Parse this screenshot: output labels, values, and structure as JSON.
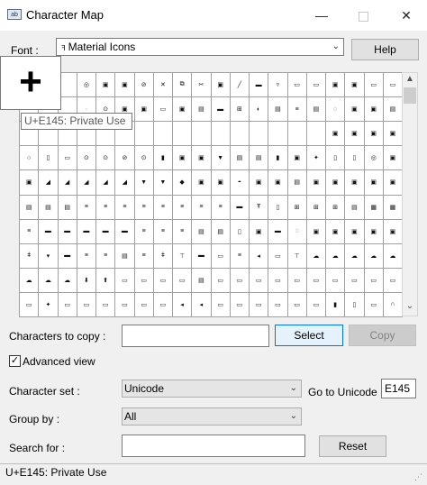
{
  "window": {
    "title": "Character Map",
    "app_icon": "charmap-icon",
    "minimize_glyph": "—",
    "close_glyph": "✕"
  },
  "font": {
    "label": "Font :",
    "value": "Material Icons",
    "font_icon_glyph": "ꟻ"
  },
  "help": {
    "label": "Help"
  },
  "magnifier": {
    "glyph": "+"
  },
  "tooltip": {
    "text": "U+E145: Private Use"
  },
  "grid": {
    "rows": [
      [
        "",
        "",
        "",
        "◎",
        "▣",
        "▣",
        "⊘",
        "✕",
        "⧉",
        "✂",
        "▣",
        "╱",
        "▬",
        "▿",
        "▭",
        "▭",
        "▣",
        "▣",
        "▭",
        "▭"
      ],
      [
        "",
        "",
        "",
        "·",
        "⊙",
        "▣",
        "▣",
        "▭",
        "▣",
        "▤",
        "▬",
        "⊞",
        "◐",
        "▤",
        "≡",
        "▤",
        "◌",
        "▣",
        "▣",
        "▤"
      ],
      [
        "",
        "",
        "",
        "",
        "",
        "",
        "",
        "",
        "",
        "",
        "",
        "",
        "",
        "",
        "",
        "",
        "▣",
        "▣",
        "▣",
        "▣"
      ],
      [
        "○",
        "▯",
        "▭",
        "⊙",
        "⊙",
        "⊘",
        "⊙",
        "▮",
        "▣",
        "▣",
        "▼",
        "▤",
        "▤",
        "▮",
        "▣",
        "✦",
        "▯",
        "▯",
        "◎",
        "▣"
      ],
      [
        "▣",
        "◢",
        "◢",
        "◢",
        "◢",
        "◢",
        "▼",
        "▼",
        "◆",
        "▣",
        "▣",
        "◓",
        "▣",
        "▣",
        "▤",
        "▣",
        "▣",
        "▣",
        "▣",
        "▣"
      ],
      [
        "▤",
        "▤",
        "▤",
        "≡",
        "≡",
        "≡",
        "≡",
        "≡",
        "≡",
        "≡",
        "≡",
        "▬",
        "Ŧ",
        "▯",
        "⊞",
        "⊞",
        "⊞",
        "▤",
        "▦",
        "▦"
      ],
      [
        "≡",
        "▬",
        "▬",
        "▬",
        "▬",
        "▬",
        "≡",
        "≡",
        "≡",
        "▤",
        "▤",
        "▯",
        "▣",
        "▬",
        "◌",
        "▣",
        "▣",
        "▣",
        "▣",
        "▣"
      ],
      [
        "ǂ",
        "▾",
        "▬",
        "≡",
        "≡",
        "▤",
        "≡",
        "ǂ",
        "⊤",
        "▬",
        "▭",
        "≡",
        "◂",
        "▭",
        "⊤",
        "☁",
        "☁",
        "☁",
        "☁",
        "☁"
      ],
      [
        "☁",
        "☁",
        "☁",
        "⬇",
        "⬆",
        "▭",
        "▭",
        "▭",
        "▭",
        "▤",
        "▭",
        "▭",
        "▭",
        "▭",
        "▭",
        "▭",
        "▭",
        "▭",
        "▭",
        "▭"
      ],
      [
        "▭",
        "✦",
        "▭",
        "▭",
        "▭",
        "▭",
        "▭",
        "▭",
        "◂",
        "◂",
        "▭",
        "▭",
        "▭",
        "▭",
        "▭",
        "▭",
        "▮",
        "▯",
        "▭",
        "∩"
      ]
    ]
  },
  "scrollbar": {
    "up_glyph": "▲",
    "down_glyph": "⌄"
  },
  "copy": {
    "label": "Characters to copy :",
    "value": "",
    "select_label": "Select",
    "copy_label": "Copy"
  },
  "advanced": {
    "check_glyph": "✓",
    "checked": true,
    "label": "Advanced view"
  },
  "charset": {
    "label": "Character set :",
    "value": "Unicode",
    "goto_label": "Go to Unicode",
    "goto_value": "E145"
  },
  "groupby": {
    "label": "Group by :",
    "value": "All"
  },
  "search": {
    "label": "Search for :",
    "value": "",
    "reset_label": "Reset"
  },
  "status": {
    "text": "U+E145: Private Use",
    "grip_glyph": "⋰"
  },
  "colors": {
    "select_border": "#0078d7",
    "select_fill": "#e5f1fb",
    "disabled_button": "#cccccc"
  }
}
